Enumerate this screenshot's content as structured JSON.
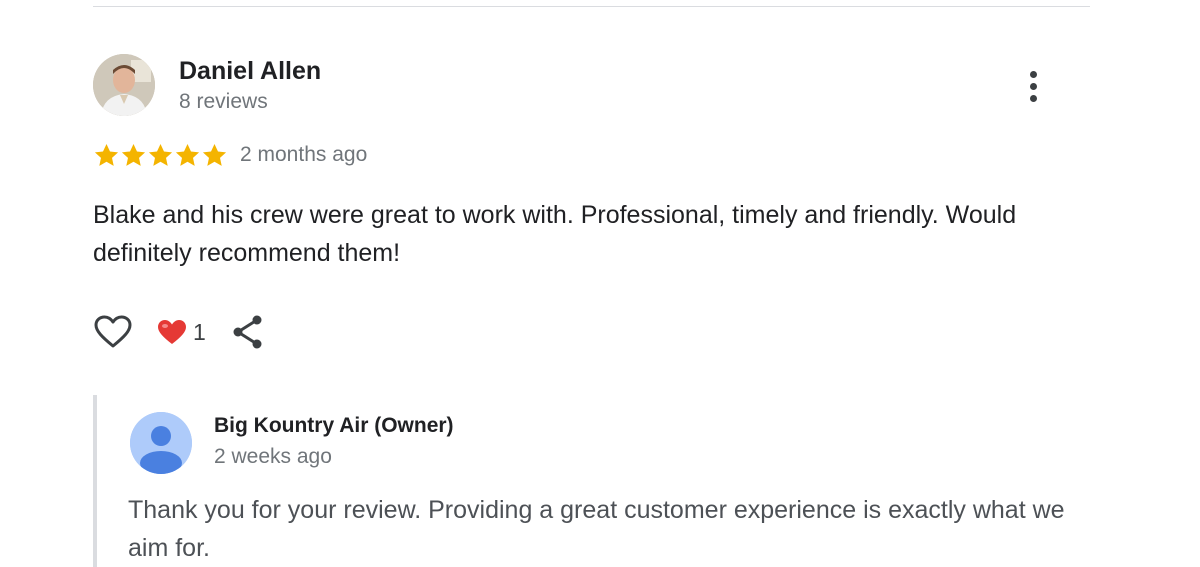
{
  "review": {
    "author_name": "Daniel Allen",
    "author_reviews": "8 reviews",
    "rating": 5,
    "rating_max": 5,
    "date": "2 months ago",
    "text": "Blake and his crew were great to work with. Professional, timely and friendly. Would definitely recommend them!",
    "reaction_count": "1",
    "icons": {
      "more": "more-vert-icon",
      "like": "heart-outline-icon",
      "reaction": "heart-emoji-icon",
      "share": "share-icon"
    }
  },
  "owner_reply": {
    "name": "Big Kountry Air (Owner)",
    "date": "2 weeks ago",
    "text": "Thank you for your review. Providing a great customer experience is exactly what we aim for."
  },
  "colors": {
    "star": "#f4b400",
    "reaction_heart": "#e53935",
    "owner_avatar_bg": "#aecbfa",
    "owner_avatar_fg": "#4a80e0",
    "muted_text": "#70757a",
    "divider": "#dadce0"
  }
}
